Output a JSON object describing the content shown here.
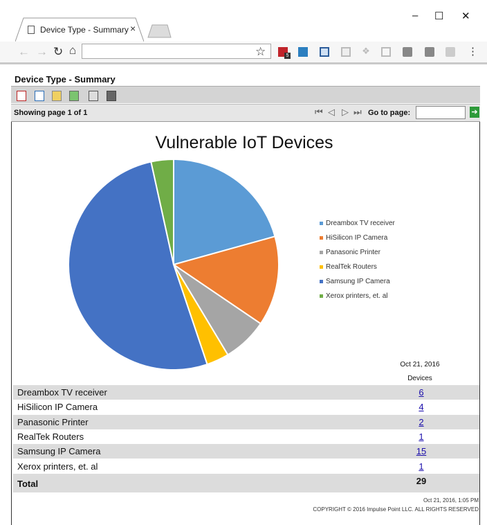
{
  "browser": {
    "tab_title": "Device Type - Summary",
    "tab_close": "×",
    "minimize": "–",
    "maximize": "☐",
    "close": "✕",
    "address": "",
    "extension_badge": "5"
  },
  "report": {
    "title": "Device Type - Summary",
    "pager": {
      "showing": "Showing page  1  of  1",
      "goto_label": "Go to page:",
      "goto_value": ""
    },
    "chart_title": "Vulnerable IoT Devices",
    "columns": {
      "date": "Oct 21, 2016",
      "devices": "Devices"
    },
    "rows": [
      {
        "label": "Dreambox TV receiver",
        "value": "6"
      },
      {
        "label": "HiSilicon IP Camera",
        "value": "4"
      },
      {
        "label": "Panasonic Printer",
        "value": "2"
      },
      {
        "label": "RealTek Routers",
        "value": "1"
      },
      {
        "label": "Samsung IP Camera",
        "value": "15"
      },
      {
        "label": "Xerox printers, et. al",
        "value": "1"
      }
    ],
    "total_label": "Total",
    "total_value": "29",
    "footer_date": "Oct 21, 2016, 1:05 PM",
    "footer_copyright": "COPYRIGHT © 2016 Impulse Point LLC. ALL RIGHTS RESERVED"
  },
  "chart_data": {
    "type": "pie",
    "title": "Vulnerable IoT Devices",
    "legend_position": "right",
    "categories": [
      "Dreambox TV receiver",
      "HiSilicon IP Camera",
      "Panasonic Printer",
      "RealTek Routers",
      "Samsung IP Camera",
      "Xerox printers, et. al"
    ],
    "legend": [
      "Dreambox TV receiver",
      "HiSilicon IP Camera",
      "Panasonic Printer",
      "RealTek Routers",
      "Samsung IP Camera",
      "Xerox printers, et. al"
    ],
    "values": [
      6,
      4,
      2,
      1,
      15,
      1
    ],
    "colors": [
      "#5B9BD5",
      "#ED7D31",
      "#A5A5A5",
      "#FFC000",
      "#4472C4",
      "#70AD47"
    ]
  }
}
